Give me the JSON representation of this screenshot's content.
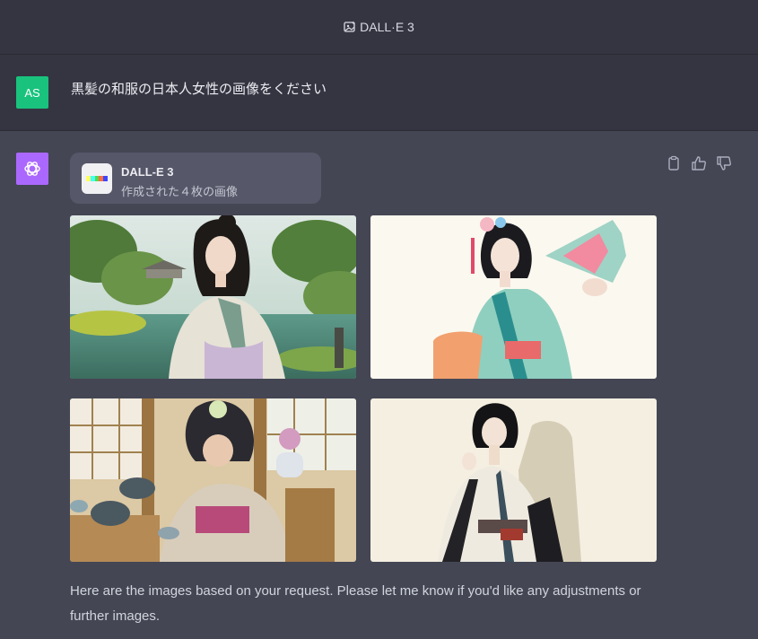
{
  "header": {
    "model_name": "DALL·E 3",
    "model_icon": "image-sparkle-icon"
  },
  "user": {
    "avatar_initials": "AS",
    "avatar_color": "#19c37d",
    "message": "黒髪の和服の日本人女性の画像をください"
  },
  "assistant": {
    "avatar_icon": "openai-logo-icon",
    "avatar_color": "#ab68ff",
    "tool_card": {
      "name": "DALL-E 3",
      "subtitle": "作成された４枚の画像"
    },
    "images": [
      {
        "name": "generated-image-1",
        "icon": "image"
      },
      {
        "name": "generated-image-2",
        "icon": "image"
      },
      {
        "name": "generated-image-3",
        "icon": "image"
      },
      {
        "name": "generated-image-4",
        "icon": "image"
      }
    ],
    "reply": "Here are the images based on your request. Please let me know if you'd like any adjustments or further images.",
    "actions": [
      "clipboard-icon",
      "thumbs-up-icon",
      "thumbs-down-icon"
    ]
  }
}
